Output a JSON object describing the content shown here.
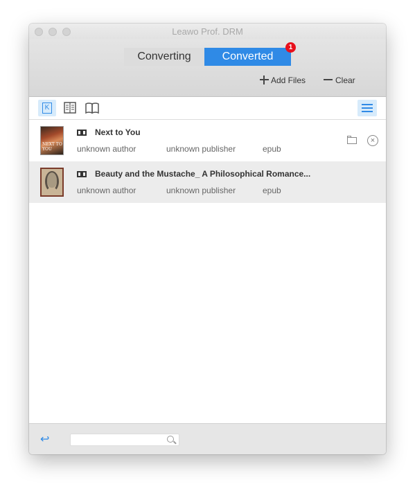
{
  "window": {
    "title": "Leawo Prof. DRM"
  },
  "tabs": {
    "converting": "Converting",
    "converted": "Converted",
    "badge_count": "1"
  },
  "actions": {
    "add_files": "Add Files",
    "clear": "Clear"
  },
  "toolbar": {
    "icons": [
      "kindle-icon",
      "document-icon",
      "open-book-icon",
      "list-view-icon"
    ],
    "kindle_glyph": "K"
  },
  "books": [
    {
      "title": "Next to You",
      "author": "unknown author",
      "publisher": "unknown publisher",
      "format": "epub",
      "cover_text": "NEXT TO YOU"
    },
    {
      "title": "Beauty and the Mustache_ A Philosophical Romance...",
      "author": "unknown author",
      "publisher": "unknown publisher",
      "format": "epub"
    }
  ],
  "footer": {
    "search_value": "",
    "undo_glyph": "↩"
  },
  "colors": {
    "accent": "#2f8ae6",
    "badge": "#e8101c",
    "selected_row": "#ececec"
  }
}
